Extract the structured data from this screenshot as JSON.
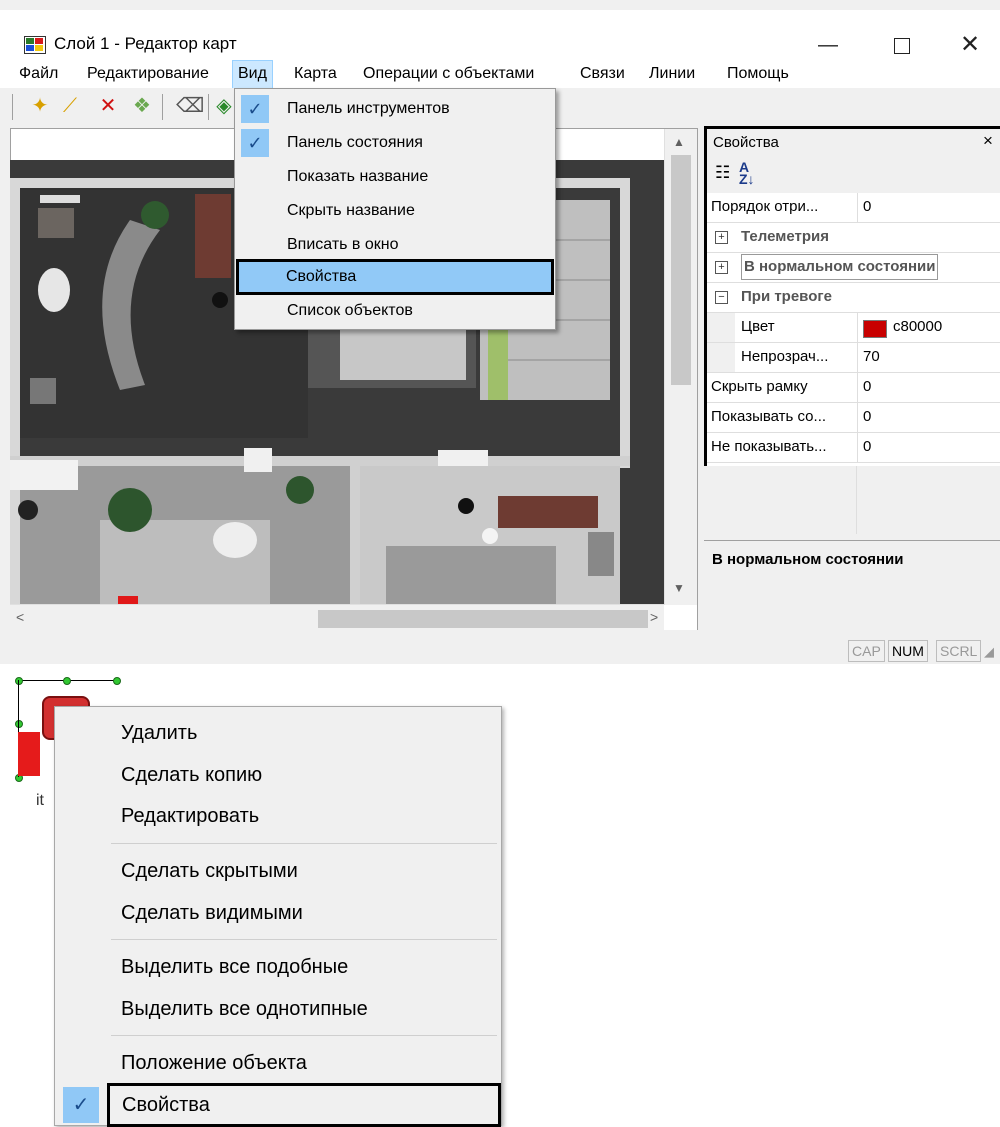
{
  "window": {
    "title": "Слой 1 - Редактор карт",
    "minimize_glyph": "—",
    "close_glyph": "✕"
  },
  "menubar": [
    "Файл",
    "Редактирование",
    "Вид",
    "Карта",
    "Операции с объектами",
    "Связи",
    "Линии",
    "Помощь"
  ],
  "view_menu": {
    "items": [
      {
        "label": "Панель инструментов",
        "checked": true
      },
      {
        "label": "Панель состояния",
        "checked": true
      },
      {
        "label": "Показать название",
        "checked": false
      },
      {
        "label": "Скрыть название",
        "checked": false
      },
      {
        "label": "Вписать в окно",
        "checked": false
      },
      {
        "label": "Свойства",
        "checked": false,
        "highlighted": true
      },
      {
        "label": "Список объектов",
        "checked": false
      }
    ]
  },
  "properties": {
    "title": "Свойства",
    "close_glyph": "×",
    "rows": [
      {
        "name": "Порядок отри...",
        "value": "0"
      },
      {
        "category": "Телеметрия",
        "expander": "+"
      },
      {
        "category": "В нормальном состоянии",
        "expander": "+"
      },
      {
        "category": "При тревоге",
        "expander": "−"
      },
      {
        "name": "Цвет",
        "value": "c80000",
        "indent": true,
        "color": "#c80000"
      },
      {
        "name": "Непрозрач...",
        "value": "70",
        "indent": true
      },
      {
        "name": "Скрыть рамку",
        "value": "0"
      },
      {
        "name": "Показывать со...",
        "value": "0"
      },
      {
        "name": "Не показывать...",
        "value": "0"
      }
    ],
    "description": "В нормальном состоянии"
  },
  "statusbar": {
    "indicators": [
      "CAP",
      "NUM",
      "SCRL"
    ]
  },
  "context_menu": {
    "object_label": "it",
    "items": [
      {
        "label": "Удалить"
      },
      {
        "label": "Сделать копию"
      },
      {
        "label": "Редактировать"
      },
      {
        "label": "Сделать скрытыми"
      },
      {
        "label": "Сделать видимыми"
      },
      {
        "label": "Выделить все подобные"
      },
      {
        "label": "Выделить все однотипные"
      },
      {
        "label": "Положение объекта"
      },
      {
        "label": "Свойства",
        "checked": true,
        "highlighted": true
      }
    ]
  },
  "colors": {
    "accent_highlight": "#91c9f7",
    "alarm_color": "#c80000"
  }
}
